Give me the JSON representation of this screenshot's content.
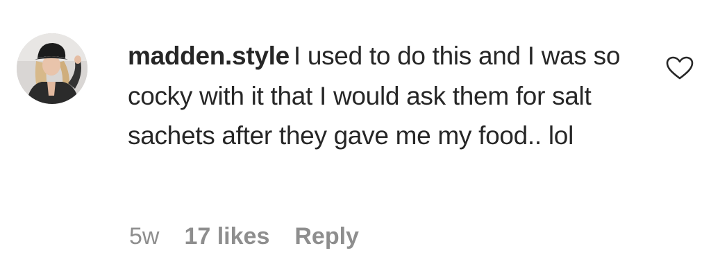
{
  "comment": {
    "username": "madden.style",
    "text": "I used to do this and I was so cocky with it that I would ask them for salt sachets after they gave me my food.. lol",
    "age": "5w",
    "likes": "17 likes",
    "reply_label": "Reply"
  },
  "icons": {
    "like": "heart-outline-icon"
  },
  "colors": {
    "text": "#262626",
    "meta": "#8e8e8e"
  }
}
